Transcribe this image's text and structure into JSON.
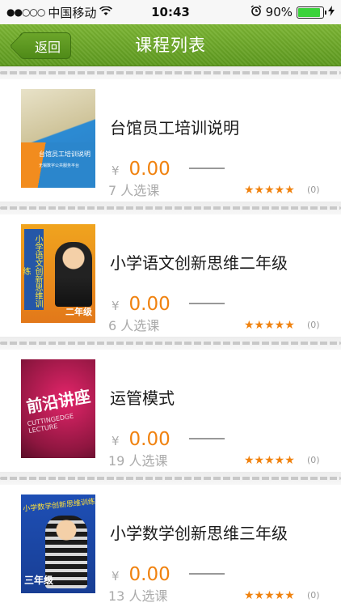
{
  "status_bar": {
    "carrier": "中国移动",
    "signal": "●●○○○",
    "time": "10:43",
    "battery_percent": "90%",
    "battery_level": 0.9
  },
  "nav": {
    "back_label": "返回",
    "title": "课程列表"
  },
  "currency_symbol": "¥",
  "courses": [
    {
      "title": "台馆员工培训说明",
      "price": "0.00",
      "enroll": "7 人选课",
      "stars": "★★★★★",
      "rating_count": "(0)",
      "thumb_text": "台馆员工培训说明",
      "thumb_sub": "无锡数字公共服务平台"
    },
    {
      "title": "小学语文创新思维二年级",
      "price": "0.00",
      "enroll": "6 人选课",
      "stars": "★★★★★",
      "rating_count": "(0)",
      "thumb_text": "小学语文创新思维训练",
      "thumb_sub": "二年级"
    },
    {
      "title": "运管模式",
      "price": "0.00",
      "enroll": "19 人选课",
      "stars": "★★★★★",
      "rating_count": "(0)",
      "thumb_text": "前沿讲座",
      "thumb_sub": "CUTTINGEDGE LECTURE"
    },
    {
      "title": "小学数学创新思维三年级",
      "price": "0.00",
      "enroll": "13 人选课",
      "stars": "★★★★★",
      "rating_count": "(0)",
      "thumb_text": "小学数学创新思维训练",
      "thumb_sub": "三年级"
    }
  ]
}
